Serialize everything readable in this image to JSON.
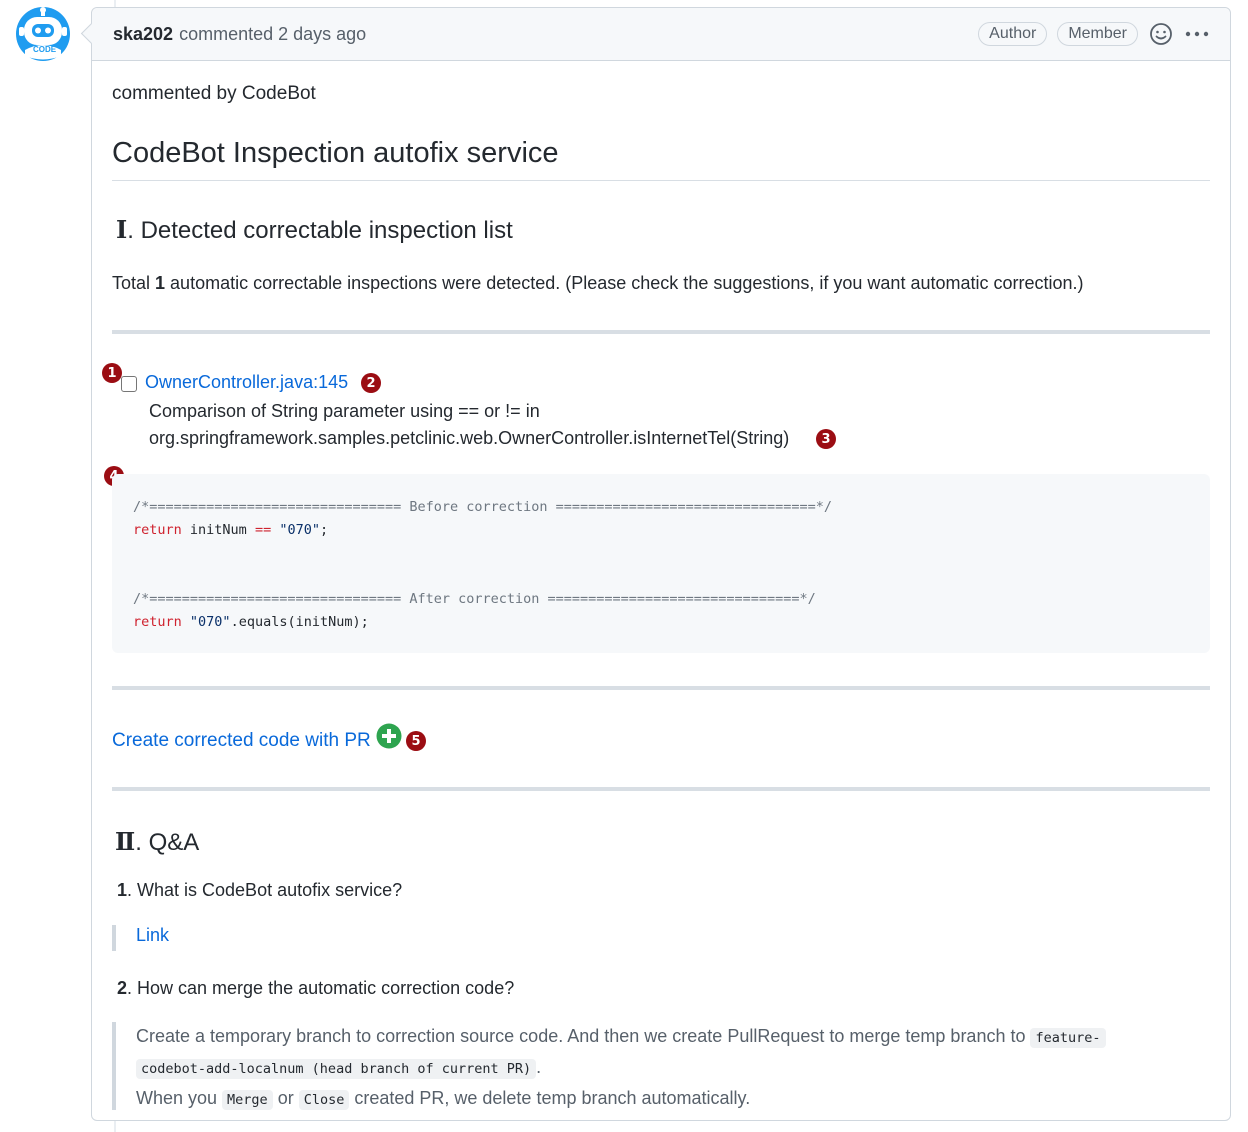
{
  "header": {
    "author": "ska202",
    "meta": "commented 2 days ago",
    "badges": [
      "Author",
      "Member"
    ],
    "icons": [
      "smiley-icon",
      "kebab-menu-icon"
    ]
  },
  "avatar": {
    "label": "CODE",
    "icon": "robot-avatar"
  },
  "body": {
    "commented_by": "commented by CodeBot",
    "title": "CodeBot Inspection autofix service",
    "section1": {
      "numeral": "Ⅰ",
      "title": ". Detected correctable inspection list"
    },
    "total": {
      "prefix": "Total ",
      "count": "1",
      "suffix": " automatic correctable inspections were detected. (Please check the suggestions, if you want automatic correction.)"
    },
    "inspection": {
      "file_link": "OwnerController.java:145",
      "line1": "Comparison of String parameter using == or != in",
      "line2": "org.springframework.samples.petclinic.web.OwnerController.isInternetTel(String)"
    },
    "code": {
      "before_comment": "/*=============================== Before correction ================================*/",
      "before_kw": "return",
      "before_plain1": " initNum ",
      "before_op": "==",
      "before_plain2": " ",
      "before_str": "\"070\"",
      "before_end": ";",
      "after_comment": "/*=============================== After correction ===============================*/",
      "after_kw": "return",
      "after_plain1": " ",
      "after_str": "\"070\"",
      "after_end": ".equals(initNum);"
    },
    "pr_link": "Create corrected code with PR",
    "section2": {
      "numeral": "Ⅱ",
      "title": ". Q&A"
    },
    "q1": {
      "num": "1",
      "text": ". What is CodeBot autofix service?"
    },
    "q1_link": "Link",
    "q2": {
      "num": "2",
      "text": ". How can merge the automatic correction code?"
    },
    "q2_answer": {
      "text1": "Create a temporary branch to correction source code. And then we create PullRequest to merge temp branch to ",
      "code1a": "feature-",
      "code1b": "codebot-add-localnum (head branch of current PR)",
      "text2": ".",
      "text3": "When you ",
      "code2": "Merge",
      "text4": " or ",
      "code3": "Close",
      "text5": " created PR, we delete temp branch automatically."
    }
  },
  "markers": [
    "1",
    "2",
    "3",
    "4",
    "5"
  ],
  "colors": {
    "link": "#0969da",
    "marker": "#9b0d13",
    "plus": "#2ea44f",
    "avatar": "#1f9cf0"
  }
}
